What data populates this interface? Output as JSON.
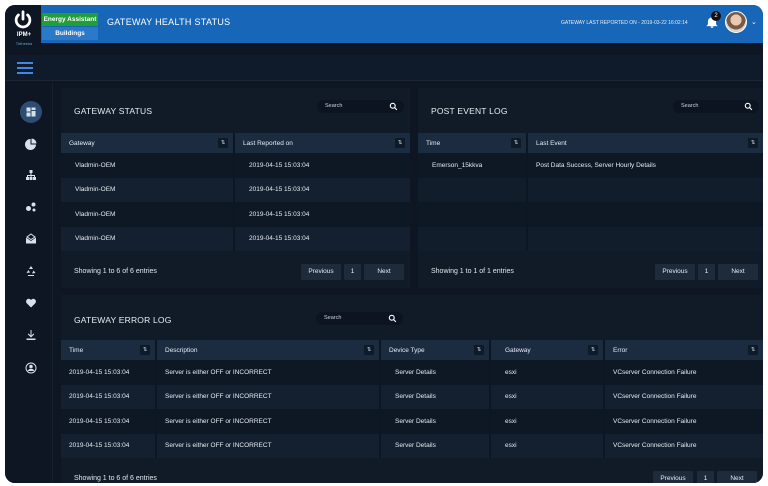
{
  "header": {
    "logo_text": "IPM+",
    "logo_subtext": "Tirthesha",
    "badge_primary": "Energy Assistant",
    "badge_secondary": "Buildings",
    "title": "GATEWAY HEALTH STATUS",
    "last_reported": "GATEWAY LAST REPORTED ON - 2019-03-22 16:02:14",
    "notification_count": "2",
    "accent_color": "#1766b8"
  },
  "sidebar": {
    "icons": [
      "dashboard-icon",
      "pie-chart-icon",
      "hierarchy-icon",
      "analytics-icon",
      "alert-mail-icon",
      "recycle-icon",
      "heart-pulse-icon",
      "download-icon",
      "user-icon"
    ]
  },
  "gateway_status": {
    "title": "GATEWAY STATUS",
    "search_placeholder": "Search",
    "columns": [
      "Gateway",
      "Last Reported on"
    ],
    "rows": [
      [
        "Vladmin-OEM",
        "2019-04-15  15:03:04"
      ],
      [
        "Vladmin-OEM",
        "2019-04-15  15:03:04"
      ],
      [
        "Vladmin-OEM",
        "2019-04-15  15:03:04"
      ],
      [
        "Vladmin-OEM",
        "2019-04-15  15:03:04"
      ]
    ],
    "showing": "Showing 1 to 6 of 6 entries",
    "prev": "Previous",
    "page": "1",
    "next": "Next"
  },
  "post_event_log": {
    "title": "POST EVENT LOG",
    "search_placeholder": "Search",
    "columns": [
      "Time",
      "Last Event"
    ],
    "rows": [
      [
        "Emerson_15kkva",
        "Post Data Success, Server Hourly Details"
      ]
    ],
    "showing": "Showing 1 to 1 of 1 entries",
    "prev": "Previous",
    "page": "1",
    "next": "Next"
  },
  "gateway_error_log": {
    "title": "GATEWAY ERROR LOG",
    "search_placeholder": "Search",
    "columns": [
      "Time",
      "Description",
      "Device Type",
      "Gateway",
      "Error"
    ],
    "rows": [
      [
        "2019-04-15  15:03:04",
        "Server is either OFF or INCORRECT",
        "Server Details",
        "esxi",
        "VCserver Connection Failure"
      ],
      [
        "2019-04-15  15:03:04",
        "Server is either OFF or INCORRECT",
        "Server Details",
        "esxi",
        "VCserver Connection Failure"
      ],
      [
        "2019-04-15  15:03:04",
        "Server is either OFF or INCORRECT",
        "Server Details",
        "esxi",
        "VCserver Connection Failure"
      ],
      [
        "2019-04-15  15:03:04",
        "Server is either OFF or INCORRECT",
        "Server Details",
        "esxi",
        "VCserver Connection Failure"
      ]
    ],
    "showing": "Showing 1 to 6 of 6 entries",
    "prev": "Previous",
    "page": "1",
    "next": "Next"
  }
}
